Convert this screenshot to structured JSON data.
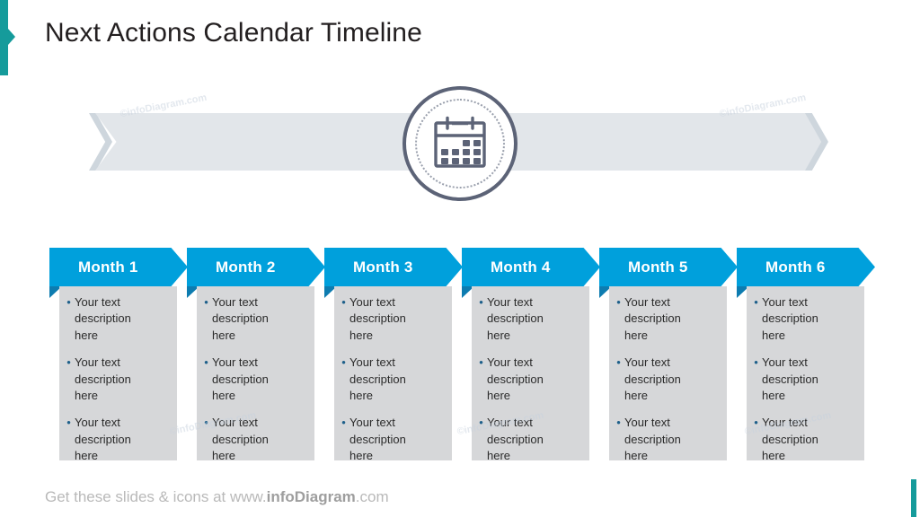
{
  "slide": {
    "title": "Next Actions Calendar Timeline",
    "accent_color": "#159b9b",
    "header_color": "#00a0dc",
    "header_fold_color": "#0d7cb0",
    "body_color": "#d6d7d9",
    "ribbon_color": "#e2e6ea",
    "ribbon_tip_color": "#ced6dd",
    "icon_color": "#5c6377"
  },
  "banner": {
    "icon_name": "calendar-icon",
    "watermarks": [
      "©infoDiagram.com",
      "©infoDiagram.com",
      "©infoDiagram.com",
      "©infoDiagram.com",
      "©infoDiagram.com"
    ]
  },
  "timeline": {
    "columns": [
      {
        "label": "Month 1",
        "bullets": [
          "Your text description here",
          "Your text description here",
          "Your text description here"
        ]
      },
      {
        "label": "Month 2",
        "bullets": [
          "Your text description here",
          "Your text description here",
          "Your text description here"
        ]
      },
      {
        "label": "Month 3",
        "bullets": [
          "Your text description here",
          "Your text description here",
          "Your text description here"
        ]
      },
      {
        "label": "Month 4",
        "bullets": [
          "Your text description here",
          "Your text description here",
          "Your text description here"
        ]
      },
      {
        "label": "Month 5",
        "bullets": [
          "Your text description here",
          "Your text description here",
          "Your text description here"
        ]
      },
      {
        "label": "Month 6",
        "bullets": [
          "Your text description here",
          "Your text description here",
          "Your text description here"
        ]
      }
    ],
    "bullet_glyph": "•"
  },
  "footer": {
    "prefix": "Get these slides & icons at www.",
    "brand": "infoDiagram",
    "suffix": ".com"
  }
}
